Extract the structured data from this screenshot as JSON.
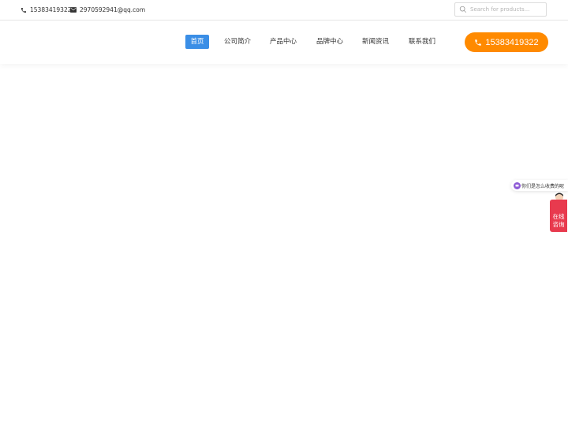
{
  "topbar": {
    "phone": "15383419322",
    "email": "2970592941@qq.com",
    "search_placeholder": "Search for products..."
  },
  "nav": {
    "items": [
      {
        "label": "首页",
        "active": true
      },
      {
        "label": "公司简介",
        "active": false
      },
      {
        "label": "产品中心",
        "active": false
      },
      {
        "label": "品牌中心",
        "active": false
      },
      {
        "label": "新闻资讯",
        "active": false
      },
      {
        "label": "联系我们",
        "active": false
      }
    ],
    "phone_button": "15383419322"
  },
  "chat_widget": {
    "bubble_text": "你们是怎么收费的呢",
    "consult_line1": "在线",
    "consult_line2": "咨询"
  },
  "colors": {
    "accent_blue": "#3a8ee6",
    "phone_orange": "#ff8a00",
    "consult_red": "#e83a4e",
    "chat_purple": "#8e5bd6"
  },
  "icons": [
    "phone-icon",
    "mail-icon",
    "search-icon",
    "chat-icon",
    "avatar"
  ]
}
